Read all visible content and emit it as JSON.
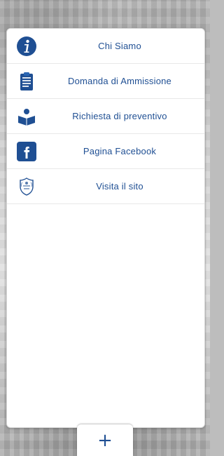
{
  "menu": {
    "items": [
      {
        "label": "Chi Siamo",
        "icon": "info-icon"
      },
      {
        "label": "Domanda di Ammissione",
        "icon": "clipboard-icon"
      },
      {
        "label": "Richiesta di preventivo",
        "icon": "reader-book-icon"
      },
      {
        "label": "Pagina Facebook",
        "icon": "facebook-icon"
      },
      {
        "label": "Visita il sito",
        "icon": "coat-of-arms-icon"
      }
    ]
  },
  "tab": {
    "plus_label": "+"
  },
  "colors": {
    "accent": "#1f4f93",
    "panel_bg": "#ffffff",
    "divider": "#e8e8e8"
  }
}
